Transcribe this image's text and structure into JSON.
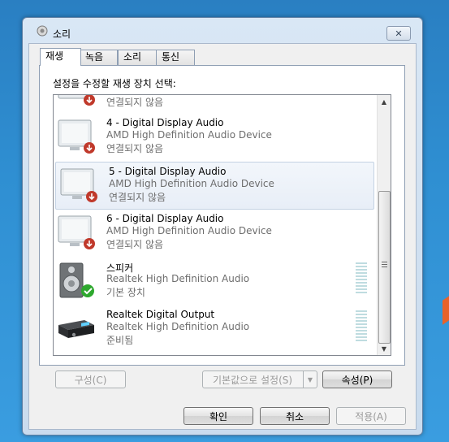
{
  "window": {
    "title": "소리",
    "close_label": "✕"
  },
  "tabs": [
    {
      "label": "재생",
      "active": true
    },
    {
      "label": "녹음",
      "active": false
    },
    {
      "label": "소리",
      "active": false
    },
    {
      "label": "통신",
      "active": false
    }
  ],
  "instruction": "설정을 수정할 재생 장치 선택:",
  "devices": [
    {
      "name": "",
      "desc": "",
      "status": "연결되지 않음",
      "icon": "monitor-disconnected-icon"
    },
    {
      "name": "4 - Digital Display Audio",
      "desc": "AMD High Definition Audio Device",
      "status": "연결되지 않음",
      "icon": "monitor-disconnected-icon"
    },
    {
      "name": "5 - Digital Display Audio",
      "desc": "AMD High Definition Audio Device",
      "status": "연결되지 않음",
      "icon": "monitor-disconnected-icon",
      "selected": true
    },
    {
      "name": "6 - Digital Display Audio",
      "desc": "AMD High Definition Audio Device",
      "status": "연결되지 않음",
      "icon": "monitor-disconnected-icon"
    },
    {
      "name": "스피커",
      "desc": "Realtek High Definition Audio",
      "status": "기본 장치",
      "icon": "speaker-default-icon"
    },
    {
      "name": "Realtek Digital Output",
      "desc": "Realtek High Definition Audio",
      "status": "준비됨",
      "icon": "digital-output-icon"
    }
  ],
  "buttons": {
    "configure": "구성(C)",
    "set_default": "기본값으로 설정(S)",
    "properties": "속성(P)",
    "ok": "확인",
    "cancel": "취소",
    "apply": "적용(A)"
  },
  "colors": {
    "accent": "#3399ff",
    "disconnected": "#c0392b",
    "default_check": "#2ea82e"
  }
}
